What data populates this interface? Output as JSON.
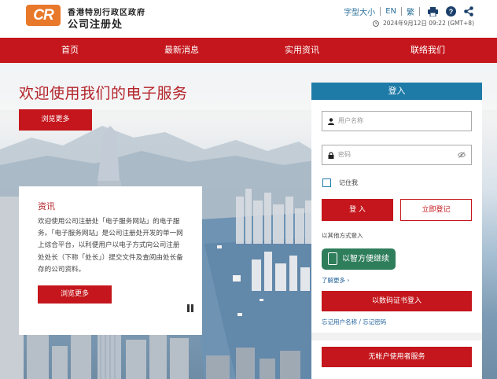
{
  "header": {
    "logo_text": "CR",
    "org_line1": "香港特別行政区政府",
    "org_line2": "公司注册处",
    "tools": {
      "font_size": "字型大小",
      "english": "EN",
      "trad_chinese": "繁"
    },
    "datetime": "2024年9月12日 09:22 (GMT+8)"
  },
  "nav": {
    "items": [
      "首页",
      "最新消息",
      "实用资讯",
      "联络我们"
    ]
  },
  "hero": {
    "title": "欢迎使用我们的电子服务",
    "browse_more": "浏览更多"
  },
  "news": {
    "heading": "资讯",
    "body": "欢迎使用公司注册处「电子服务网站」的电子服务。「电子服务网站」是公司注册处开发的单一网上综合平台，以利便用户以电子方式向公司注册处处长（下称「处长」）提交文件及查阅由处长备存的公司资料。",
    "browse_more": "浏览更多"
  },
  "login": {
    "heading": "登入",
    "username_placeholder": "用户名称",
    "password_placeholder": "密码",
    "remember_me": "记住我",
    "login_button": "登 入",
    "register_button": "立即登记",
    "other_methods": "以其他方式登入",
    "iam_smart": "以智方便继续",
    "learn_more": "了解更多 ›",
    "cert_login": "以数码证书登入",
    "forgot": "忘记用户名称 / 忘记密码",
    "no_account": "无帐户使用者服务"
  },
  "colors": {
    "brand_red": "#c4161c",
    "login_header_blue": "#1e7ba8",
    "logo_orange": "#e8782a",
    "iam_green": "#2e7d5b"
  }
}
